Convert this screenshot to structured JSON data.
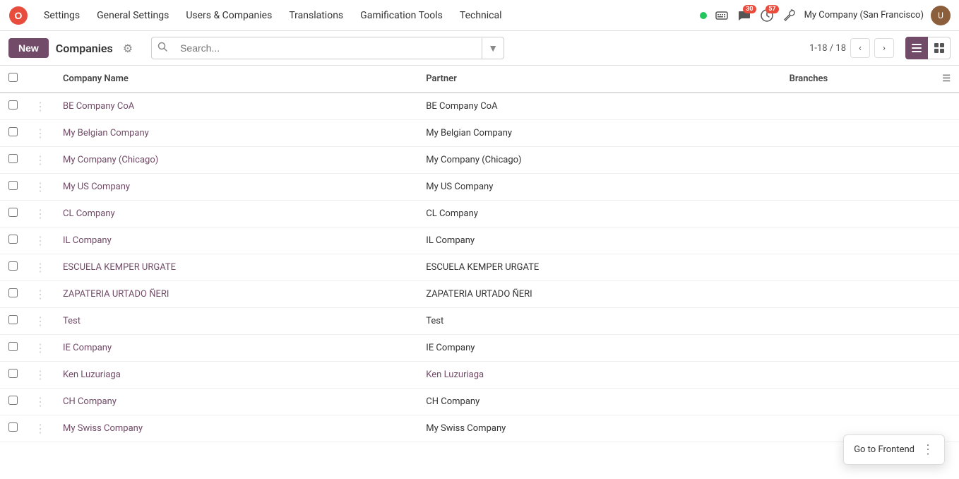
{
  "app": {
    "logo_letter": "O",
    "logo_color": "#e84c3d"
  },
  "topnav": {
    "items": [
      {
        "id": "settings",
        "label": "Settings"
      },
      {
        "id": "general-settings",
        "label": "General Settings"
      },
      {
        "id": "users-companies",
        "label": "Users & Companies"
      },
      {
        "id": "translations",
        "label": "Translations"
      },
      {
        "id": "gamification",
        "label": "Gamification Tools"
      },
      {
        "id": "technical",
        "label": "Technical"
      }
    ],
    "right": {
      "company": "My Company (San Francisco)",
      "message_badge": "30",
      "activity_badge": "57"
    }
  },
  "toolbar": {
    "new_label": "New",
    "page_title": "Companies",
    "search_placeholder": "Search...",
    "pagination": "1-18 / 18"
  },
  "table": {
    "headers": [
      "Company Name",
      "Partner",
      "Branches"
    ],
    "rows": [
      {
        "company": "BE Company CoA",
        "partner": "BE Company CoA",
        "partner_link": false,
        "branches": ""
      },
      {
        "company": "My Belgian Company",
        "partner": "My Belgian Company",
        "partner_link": false,
        "branches": ""
      },
      {
        "company": "My Company (Chicago)",
        "partner": "My Company (Chicago)",
        "partner_link": false,
        "branches": ""
      },
      {
        "company": "My US Company",
        "partner": "My US Company",
        "partner_link": false,
        "branches": ""
      },
      {
        "company": "CL Company",
        "partner": "CL Company",
        "partner_link": false,
        "branches": ""
      },
      {
        "company": "IL Company",
        "partner": "IL Company",
        "partner_link": false,
        "branches": ""
      },
      {
        "company": "ESCUELA KEMPER URGATE",
        "partner": "ESCUELA KEMPER URGATE",
        "partner_link": false,
        "branches": ""
      },
      {
        "company": "ZAPATERIA URTADO ÑERI",
        "partner": "ZAPATERIA URTADO ÑERI",
        "partner_link": false,
        "branches": ""
      },
      {
        "company": "Test",
        "partner": "Test",
        "partner_link": false,
        "branches": ""
      },
      {
        "company": "IE Company",
        "partner": "IE Company",
        "partner_link": false,
        "branches": ""
      },
      {
        "company": "Ken Luzuriaga",
        "partner": "Ken Luzuriaga",
        "partner_link": true,
        "branches": ""
      },
      {
        "company": "CH Company",
        "partner": "CH Company",
        "partner_link": false,
        "branches": ""
      },
      {
        "company": "My Swiss Company",
        "partner": "My Swiss Company",
        "partner_link": false,
        "branches": ""
      }
    ]
  },
  "popup": {
    "label": "Go to Frontend"
  }
}
